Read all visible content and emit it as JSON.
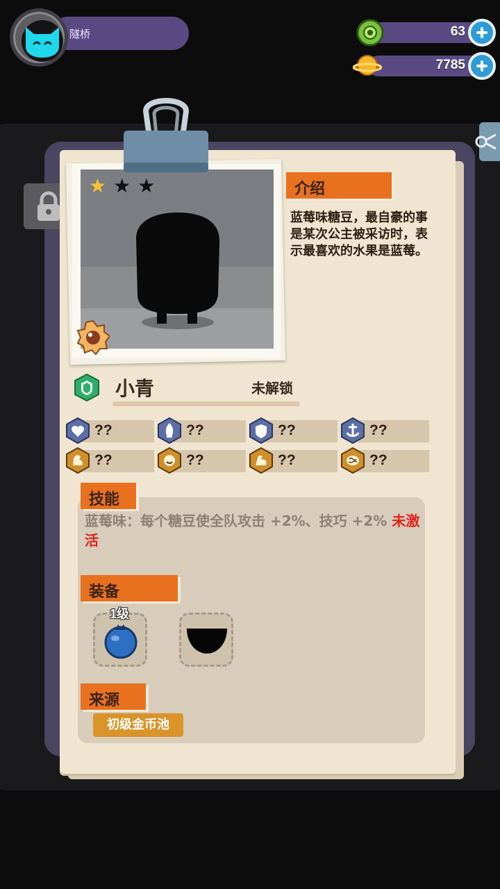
{
  "player": {
    "name": "隧桥",
    "avatar_icon": "cat-avatar-icon"
  },
  "currencies": [
    {
      "icon": "green-gem-icon",
      "value": "63"
    },
    {
      "icon": "gold-planet-icon",
      "value": "7785"
    }
  ],
  "card": {
    "stars_filled": 1,
    "stars_total": 3,
    "intro": {
      "label": "介绍",
      "text": "蓝莓味糖豆，最自豪的事是某次公主被采访时，表示最喜欢的水果是蓝莓。"
    },
    "name": "小青",
    "status": "未解锁",
    "stats": [
      {
        "icon": "heart-shield-icon",
        "value": "??"
      },
      {
        "icon": "flame-icon",
        "value": "??"
      },
      {
        "icon": "shield-icon",
        "value": "??"
      },
      {
        "icon": "anchor-icon",
        "value": "??"
      },
      {
        "icon": "muscle-icon",
        "value": "??"
      },
      {
        "icon": "smile-icon",
        "value": "??"
      },
      {
        "icon": "arm-icon",
        "value": "??"
      },
      {
        "icon": "brain-icon",
        "value": "??"
      }
    ],
    "skill": {
      "label": "技能",
      "text": "蓝莓味：每个糖豆使全队攻击 +2%、技巧 +2% ",
      "inactive": "未激活"
    },
    "equipment": {
      "label": "装备",
      "items": [
        {
          "level": "1级",
          "icon": "blueberry-icon"
        },
        {
          "icon": "bowl-silhouette-icon"
        }
      ]
    },
    "source": {
      "label": "来源",
      "button": "初级金币池"
    }
  },
  "colors": {
    "accent_orange": "#e8711f",
    "paper": "#efe5d0",
    "hud_bar": "#5a4a84",
    "plus_blue": "#2f9bd8",
    "inactive_red": "#e0241b"
  }
}
